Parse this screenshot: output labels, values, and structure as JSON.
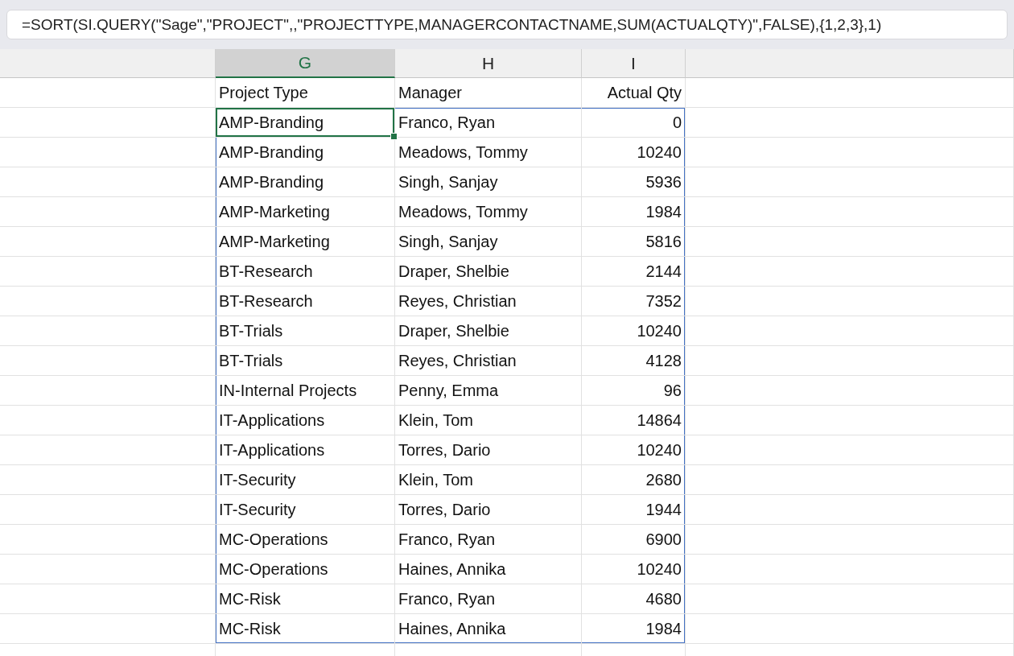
{
  "formula_bar": {
    "value": "=SORT(SI.QUERY(\"Sage\",\"PROJECT\",,\"PROJECTTYPE,MANAGERCONTACTNAME,SUM(ACTUALQTY)\",FALSE),{1,2,3},1)"
  },
  "columns": [
    {
      "label": "G",
      "selected": true
    },
    {
      "label": "H",
      "selected": false
    },
    {
      "label": "I",
      "selected": false
    }
  ],
  "header": [
    "Project Type",
    "Manager",
    "Actual Qty"
  ],
  "rows": [
    {
      "type": "AMP-Branding",
      "manager": "Franco, Ryan",
      "qty": "0",
      "selected": true
    },
    {
      "type": "AMP-Branding",
      "manager": "Meadows, Tommy",
      "qty": "10240",
      "selected": false
    },
    {
      "type": "AMP-Branding",
      "manager": "Singh, Sanjay",
      "qty": "5936",
      "selected": false
    },
    {
      "type": "AMP-Marketing",
      "manager": "Meadows, Tommy",
      "qty": "1984",
      "selected": false
    },
    {
      "type": "AMP-Marketing",
      "manager": "Singh, Sanjay",
      "qty": "5816",
      "selected": false
    },
    {
      "type": "BT-Research",
      "manager": "Draper, Shelbie",
      "qty": "2144",
      "selected": false
    },
    {
      "type": "BT-Research",
      "manager": "Reyes, Christian",
      "qty": "7352",
      "selected": false
    },
    {
      "type": "BT-Trials",
      "manager": "Draper, Shelbie",
      "qty": "10240",
      "selected": false
    },
    {
      "type": "BT-Trials",
      "manager": "Reyes, Christian",
      "qty": "4128",
      "selected": false
    },
    {
      "type": "IN-Internal Projects",
      "manager": "Penny, Emma",
      "qty": "96",
      "selected": false
    },
    {
      "type": "IT-Applications",
      "manager": "Klein, Tom",
      "qty": "14864",
      "selected": false
    },
    {
      "type": "IT-Applications",
      "manager": "Torres, Dario",
      "qty": "10240",
      "selected": false
    },
    {
      "type": "IT-Security",
      "manager": "Klein, Tom",
      "qty": "2680",
      "selected": false
    },
    {
      "type": "IT-Security",
      "manager": "Torres, Dario",
      "qty": "1944",
      "selected": false
    },
    {
      "type": "MC-Operations",
      "manager": "Franco, Ryan",
      "qty": "6900",
      "selected": false
    },
    {
      "type": "MC-Operations",
      "manager": "Haines, Annika",
      "qty": "10240",
      "selected": false
    },
    {
      "type": "MC-Risk",
      "manager": "Franco, Ryan",
      "qty": "4680",
      "selected": false
    },
    {
      "type": "MC-Risk",
      "manager": "Haines, Annika",
      "qty": "1984",
      "selected": false
    }
  ]
}
